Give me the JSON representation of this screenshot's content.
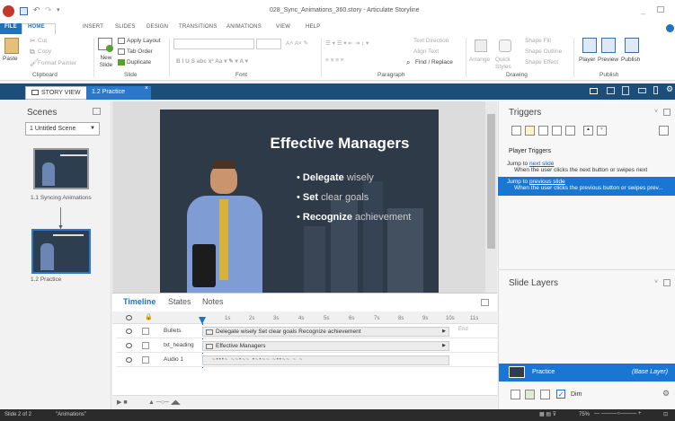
{
  "window": {
    "title": "028_Sync_Animations_360.story - Articulate Storyline"
  },
  "ribbon_tabs": [
    "FILE",
    "HOME",
    "INSERT",
    "SLIDES",
    "DESIGN",
    "TRANSITIONS",
    "ANIMATIONS",
    "VIEW",
    "HELP"
  ],
  "clipboard": {
    "paste": "Paste",
    "cut": "Cut",
    "copy": "Copy",
    "format_painter": "Format Painter",
    "label": "Clipboard"
  },
  "slide_group": {
    "new_slide": "New Slide",
    "apply_layout": "Apply Layout",
    "tab_order": "Tab Order",
    "duplicate": "Duplicate",
    "label": "Slide"
  },
  "font_group": {
    "label": "Font"
  },
  "paragraph_group": {
    "text_direction": "Text Direction",
    "align_text": "Align Text",
    "find_replace": "Find / Replace",
    "label": "Paragraph"
  },
  "drawing_group": {
    "arrange": "Arrange",
    "quick_styles": "Quick Styles",
    "shape_fill": "Shape Fill",
    "shape_outline": "Shape Outline",
    "shape_effect": "Shape Effect",
    "label": "Drawing"
  },
  "publish_group": {
    "player": "Player",
    "preview": "Preview",
    "publish": "Publish",
    "label": "Publish"
  },
  "doc_tabs": {
    "story_view": "STORY VIEW",
    "practice": "1.2 Practice"
  },
  "scenes": {
    "title": "Scenes",
    "scene_select": "1 Untitled Scene",
    "slide1_label": "1.1 Syncing Animations",
    "slide2_label": "1.2 Practice"
  },
  "slide": {
    "heading": "Effective Managers",
    "bullets": [
      {
        "bold": "Delegate",
        "rest": " wisely"
      },
      {
        "bold": "Set",
        "rest": " clear goals"
      },
      {
        "bold": "Recognize",
        "rest": " achievement"
      }
    ]
  },
  "timeline": {
    "tabs": [
      "Timeline",
      "States",
      "Notes"
    ],
    "ticks": [
      "1s",
      "2s",
      "3s",
      "4s",
      "5s",
      "6s",
      "7s",
      "8s",
      "9s",
      "10s",
      "11s"
    ],
    "end_label": "End",
    "rows": [
      {
        "name": "Bullets",
        "bar": "Delegate wisely Set clear goals Recognize achievement"
      },
      {
        "name": "txt_heading",
        "bar": "Effective Managers"
      },
      {
        "name": "Audio 1",
        "bar": ""
      }
    ]
  },
  "triggers": {
    "title": "Triggers",
    "group": "Player Triggers",
    "items": [
      {
        "prefix": "Jump to ",
        "link": "next slide",
        "detail": "When the user clicks the next button or swipes next"
      },
      {
        "prefix": "Jump to ",
        "link": "previous slide",
        "detail": "When the user clicks the previous button or swipes prev..."
      }
    ]
  },
  "layers": {
    "title": "Slide Layers",
    "base_name": "Practice",
    "base_tag": "(Base Layer)",
    "dim": "Dim"
  },
  "status": {
    "slide": "Slide 2 of 2",
    "theme": "\"Animations\"",
    "zoom": "75%"
  },
  "colors": {
    "accent": "#1e73be",
    "dark": "#1d4e79",
    "status": "#2b2b2b",
    "select": "#1976d2"
  }
}
